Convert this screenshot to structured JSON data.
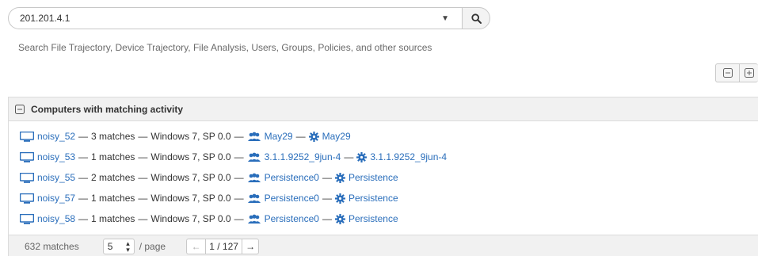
{
  "search": {
    "value": "201.201.4.1",
    "hint": "Search File Trajectory, Device Trajectory, File Analysis, Users, Groups, Policies, and other sources"
  },
  "panel": {
    "title": "Computers with matching activity",
    "rows": [
      {
        "host": "noisy_52",
        "matches": "3 matches",
        "os": "Windows 7, SP 0.0",
        "group": "May29",
        "policy": "May29"
      },
      {
        "host": "noisy_53",
        "matches": "1 matches",
        "os": "Windows 7, SP 0.0",
        "group": "3.1.1.9252_9jun-4",
        "policy": "3.1.1.9252_9jun-4"
      },
      {
        "host": "noisy_55",
        "matches": "2 matches",
        "os": "Windows 7, SP 0.0",
        "group": "Persistence0",
        "policy": "Persistence"
      },
      {
        "host": "noisy_57",
        "matches": "1 matches",
        "os": "Windows 7, SP 0.0",
        "group": "Persistence0",
        "policy": "Persistence"
      },
      {
        "host": "noisy_58",
        "matches": "1 matches",
        "os": "Windows 7, SP 0.0",
        "group": "Persistence0",
        "policy": "Persistence"
      }
    ],
    "separator": "—"
  },
  "pager": {
    "total": "632 matches",
    "per_page": "5",
    "per_page_label": "/ page",
    "page": "1 / 127"
  },
  "colors": {
    "link": "#2a6ebb",
    "header_bg": "#f1f1f1"
  }
}
